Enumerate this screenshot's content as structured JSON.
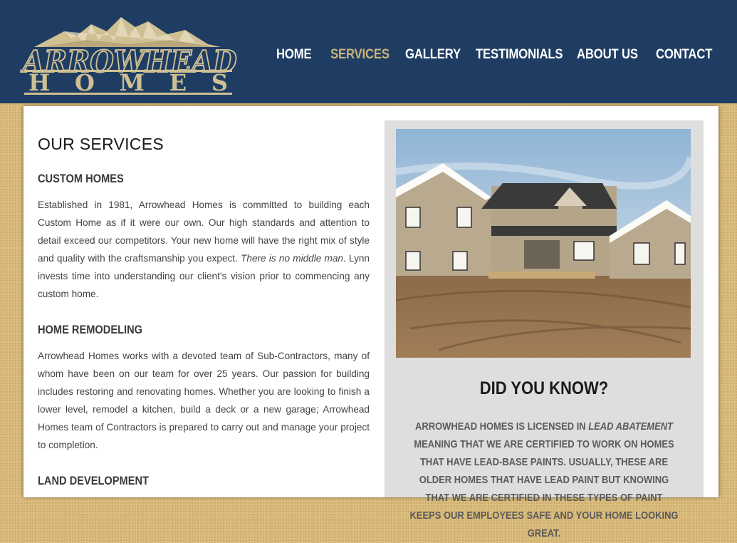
{
  "brand": {
    "line1": "ARROWHEAD",
    "line2": [
      "H",
      "O",
      "M",
      "E",
      "S"
    ]
  },
  "nav": [
    "HOME",
    "SERVICES",
    "GALLERY",
    "TESTIMONIALS",
    "ABOUT US",
    "CONTACT"
  ],
  "active_nav": "SERVICES",
  "page_title": "OUR SERVICES",
  "sections": [
    {
      "title": "CUSTOM HOMES",
      "text_before": "Established in 1981, Arrowhead Homes is committed to building each Custom Home as if it were our own. Our high standards and attention to detail exceed our competitors. Your new home will have the right mix of style and quality with the craftsmanship you expect. ",
      "text_emphasis": "There is no middle man",
      "text_after": ". Lynn invests time into understanding our client's vision prior to commencing any custom home."
    },
    {
      "title": "HOME REMODELING",
      "text": "Arrowhead Homes works with a devoted team of Sub-Contractors, many of whom have been on our team for over 25 years. Our passion for building includes restoring and renovating homes. Whether you are looking to finish a lower level, remodel a kitchen, build a deck or a new garage; Arrowhead Homes team of Contractors is prepared to carry out and manage your project to completion."
    },
    {
      "title": "LAND DEVELOPMENT"
    }
  ],
  "did_you_know": {
    "title": "DID YOU KNOW?",
    "text_before": "Arrowhead Homes is licensed in ",
    "text_emphasis": "Lead Abatement",
    "text_after": " meaning that we are certified to work on homes that have lead-base paints. Usually, these are older homes that have lead paint but knowing that we are certified in these types of paint keeps our employees safe and your home looking great."
  },
  "colors": {
    "header": "#1f3d63",
    "accent": "#c9b47b",
    "background": "#d9bb7c",
    "panel": "#dedede"
  },
  "icons": {
    "photo": "house-photo",
    "logo": "mountain-logo"
  }
}
